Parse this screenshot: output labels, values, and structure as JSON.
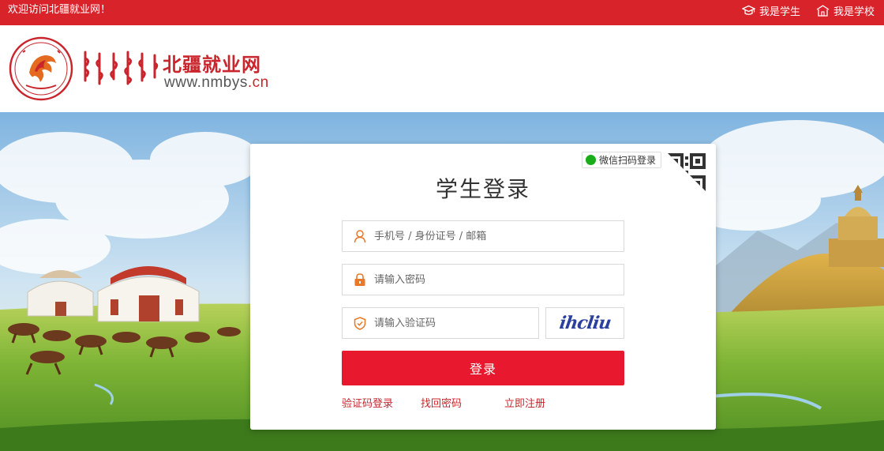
{
  "topbar": {
    "welcome": "欢迎访问北疆就业网！",
    "student_link": "我是学生",
    "school_link": "我是学校"
  },
  "header": {
    "site_title": "北疆就业网",
    "url_main": "www.nmbys",
    "url_suffix": ".cn"
  },
  "login": {
    "wechat_tip": "微信扫码登录",
    "title": "学生登录",
    "account_placeholder": "手机号 / 身份证号 / 邮箱",
    "password_placeholder": "请输入密码",
    "captcha_placeholder": "请输入验证码",
    "captcha_text": "ihcliu",
    "submit_label": "登录",
    "sms_login_link": "验证码登录",
    "forgot_password_link": "找回密码",
    "register_link": "立即注册"
  },
  "colors": {
    "brand_red": "#d9232a",
    "button_red": "#e8182e",
    "link_red": "#c8262c"
  }
}
